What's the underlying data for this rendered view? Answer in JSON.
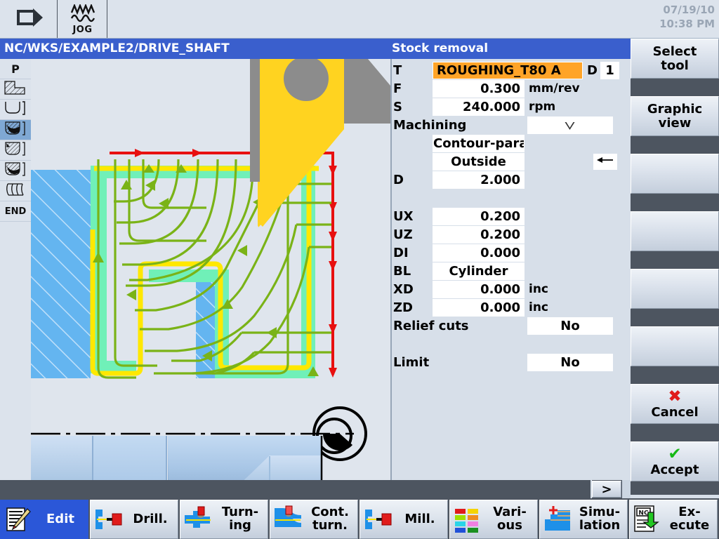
{
  "statusbar": {
    "mode_icon": "channel-mode-icon",
    "jog_icon": "jog-waves-icon",
    "jog_label": "JOG",
    "date": "07/19/10",
    "time": "10:38 PM"
  },
  "titlebar": {
    "program_path": "NC/WKS/EXAMPLE2/DRIVE_SHAFT",
    "cycle_title": "Stock removal"
  },
  "left_icons": [
    {
      "name": "program-start-icon",
      "text": "P",
      "selected": false
    },
    {
      "name": "contour-step-icon",
      "text": "",
      "selected": false
    },
    {
      "name": "contour-pocket-icon",
      "text": "",
      "selected": false
    },
    {
      "name": "stock-removal-icon",
      "text": "",
      "selected": true
    },
    {
      "name": "residual-cut-icon",
      "text": "",
      "selected": false
    },
    {
      "name": "finishing-icon",
      "text": "",
      "selected": false
    },
    {
      "name": "thread-icon",
      "text": "",
      "selected": false
    },
    {
      "name": "program-end-icon",
      "text": "END",
      "selected": false
    }
  ],
  "form": {
    "tool": {
      "label": "T",
      "value": "ROUGHING_T80 A",
      "d_label": "D",
      "d_value": "1"
    },
    "feed": {
      "label": "F",
      "value": "0.300",
      "unit": "mm/rev"
    },
    "speed": {
      "label": "S",
      "value": "240.000",
      "unit": "rpm"
    },
    "machining": {
      "label": "Machining",
      "value": "",
      "caret": "chevron-down-icon"
    },
    "strategy": {
      "value": "Contour-parall"
    },
    "side": {
      "value": "Outside"
    },
    "depth": {
      "label": "D",
      "value": "2.000"
    },
    "ux": {
      "label": "UX",
      "value": "0.200"
    },
    "uz": {
      "label": "UZ",
      "value": "0.200"
    },
    "di": {
      "label": "DI",
      "value": "0.000"
    },
    "bl": {
      "label": "BL",
      "value": "Cylinder"
    },
    "xd": {
      "label": "XD",
      "value": "0.000",
      "unit": "inc"
    },
    "zd": {
      "label": "ZD",
      "value": "0.000",
      "unit": "inc"
    },
    "relief_cuts": {
      "label": "Relief cuts",
      "value": "No"
    },
    "limit": {
      "label": "Limit",
      "value": "No"
    },
    "back_button": "left-arrow-icon"
  },
  "softkeys": [
    {
      "label": "Select\ntool",
      "glyph": "",
      "empty": false
    },
    {
      "label": "Graphic\nview",
      "glyph": "",
      "empty": false
    },
    {
      "label": "",
      "glyph": "",
      "empty": true
    },
    {
      "label": "",
      "glyph": "",
      "empty": true
    },
    {
      "label": "",
      "glyph": "",
      "empty": true
    },
    {
      "label": "",
      "glyph": "",
      "empty": true
    },
    {
      "label": "Cancel",
      "glyph": "✖",
      "empty": false,
      "glyph_class": "x"
    },
    {
      "label": "Accept",
      "glyph": "✔",
      "empty": false,
      "glyph_class": "v"
    }
  ],
  "scroll_strip": {
    "next_button": ">"
  },
  "hkeys": [
    {
      "label": "Edit",
      "icon": "edit-notepad-pencil-icon",
      "active": true
    },
    {
      "label": "Drill.",
      "icon": "drilling-tool-icon",
      "active": false
    },
    {
      "label": "Turn-\ning",
      "icon": "turning-tool-icon",
      "active": false
    },
    {
      "label": "Cont.\nturn.",
      "icon": "contour-turning-icon",
      "active": false
    },
    {
      "label": "Mill.",
      "icon": "milling-tool-icon",
      "active": false
    },
    {
      "label": "Vari-\nous",
      "icon": "various-blocks-icon",
      "active": false
    },
    {
      "label": "Simu-\nlation",
      "icon": "simulation-steps-icon",
      "active": false
    },
    {
      "label": "Ex-\necute",
      "icon": "nc-execute-icon",
      "active": false
    }
  ],
  "colors": {
    "title_blue": "#3a5fcd",
    "panel_bg": "#d7dfe9",
    "softkey_bg": "#4d5560",
    "highlight_orange": "#ffa428",
    "active_key_blue": "#2b57d8",
    "blank_blue": "#64b5f0",
    "path_red": "#e81010",
    "path_yellow": "#ffe800",
    "path_green": "#7ab317",
    "finish_green": "#70f0b8",
    "tool_yellow": "#ffd320",
    "selected_icon_blue": "#7fa8d4"
  },
  "graphic": {
    "name": "stock-removal-simulation-view",
    "elements": [
      "workpiece-blank-hatched",
      "finished-contour-yellow",
      "toolpath-green-arrows",
      "approach-path-red",
      "turning-tool-insert-yellow",
      "centerline-dash-dot",
      "mirrored-part-shaded"
    ]
  }
}
